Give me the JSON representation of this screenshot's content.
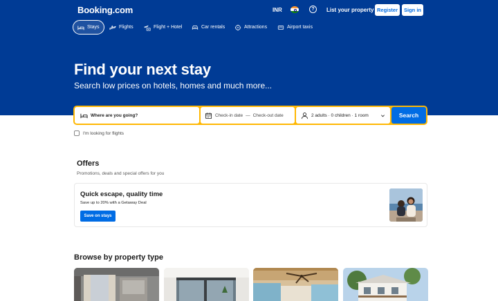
{
  "header": {
    "logo": "Booking.com",
    "currency": "INR",
    "language_flag": "india-flag-icon",
    "help_icon": "help-circle-icon",
    "help_glyph": "?",
    "list_property": "List your property",
    "register": "Register",
    "sign_in": "Sign in"
  },
  "nav": {
    "items": [
      {
        "label": "Stays",
        "icon": "bed-icon",
        "active": true
      },
      {
        "label": "Flights",
        "icon": "plane-icon",
        "active": false
      },
      {
        "label": "Flight + Hotel",
        "icon": "flight-hotel-icon",
        "active": false
      },
      {
        "label": "Car rentals",
        "icon": "car-icon",
        "active": false
      },
      {
        "label": "Attractions",
        "icon": "attractions-icon",
        "active": false
      },
      {
        "label": "Airport taxis",
        "icon": "taxi-icon",
        "active": false
      }
    ]
  },
  "hero": {
    "title": "Find your next stay",
    "subtitle": "Search low prices on hotels, homes and much more..."
  },
  "search": {
    "destination_placeholder": "Where are you going?",
    "checkin": "Check-in date",
    "separator": "—",
    "checkout": "Check-out date",
    "guests": "2 adults · 0 children · 1 room",
    "button": "Search",
    "flights_checkbox": "I'm looking for flights"
  },
  "offers": {
    "title": "Offers",
    "subtitle": "Promotions, deals and special offers for you",
    "card": {
      "title": "Quick escape, quality time",
      "text": "Save up to 20% with a Getaway Deal",
      "button": "Save on stays"
    }
  },
  "browse": {
    "title": "Browse by property type"
  },
  "colors": {
    "brand_blue": "#003b95",
    "accent_blue": "#006ce4",
    "search_border": "#ffb700"
  }
}
